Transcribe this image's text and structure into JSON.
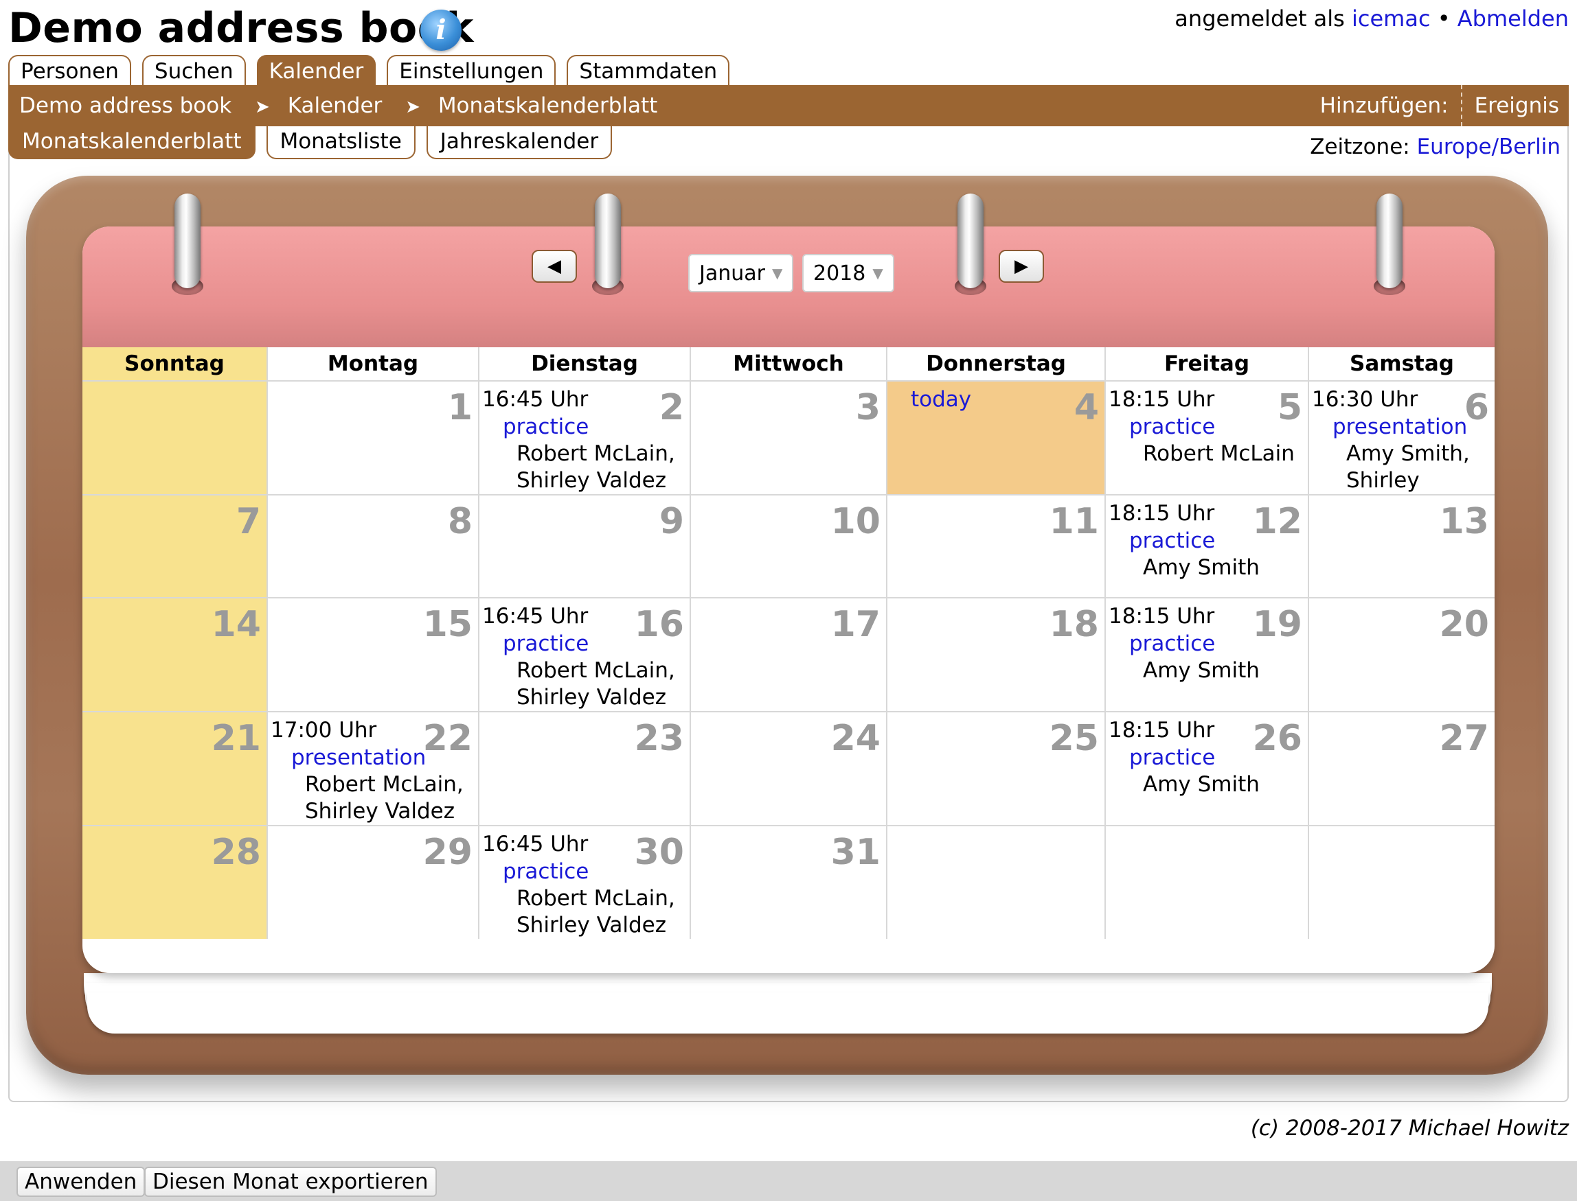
{
  "app": {
    "title": "Demo address book",
    "info_glyph": "i"
  },
  "login": {
    "prefix": "angemeldet als",
    "user": "icemac",
    "bullet": "•",
    "logout": "Abmelden"
  },
  "tabs": [
    {
      "label": "Personen",
      "active": false
    },
    {
      "label": "Suchen",
      "active": false
    },
    {
      "label": "Kalender",
      "active": true
    },
    {
      "label": "Einstellungen",
      "active": false
    },
    {
      "label": "Stammdaten",
      "active": false
    }
  ],
  "breadcrumb": {
    "items": [
      "Demo address book",
      "Kalender",
      "Monatskalenderblatt"
    ],
    "separator": "➤"
  },
  "add": {
    "label": "Hinzufügen:",
    "item": "Ereignis"
  },
  "subtabs": [
    {
      "label": "Monatskalenderblatt",
      "active": true
    },
    {
      "label": "Monatsliste",
      "active": false
    },
    {
      "label": "Jahreskalender",
      "active": false
    }
  ],
  "timezone": {
    "label": "Zeitzone:",
    "value": "Europe/Berlin"
  },
  "calendar": {
    "prev": "◀",
    "next": "▶",
    "month": "Januar",
    "year": "2018",
    "caret": "▼",
    "weekdays": [
      "Sonntag",
      "Montag",
      "Dienstag",
      "Mittwoch",
      "Donnerstag",
      "Freitag",
      "Samstag"
    ],
    "today_label": "today",
    "weeks": [
      [
        {
          "day": ""
        },
        {
          "day": "1"
        },
        {
          "day": "2",
          "event": {
            "time": "16:45 Uhr",
            "title": "practice",
            "people": [
              "Robert McLain,",
              "Shirley Valdez"
            ]
          }
        },
        {
          "day": "3"
        },
        {
          "day": "4",
          "today": true
        },
        {
          "day": "5",
          "event": {
            "time": "18:15 Uhr",
            "title": "practice",
            "people": [
              "Robert McLain"
            ]
          }
        },
        {
          "day": "6",
          "event": {
            "time": "16:30 Uhr",
            "title": "presentation",
            "people": [
              "Amy Smith,",
              "Shirley Valdez"
            ]
          }
        }
      ],
      [
        {
          "day": "7"
        },
        {
          "day": "8"
        },
        {
          "day": "9"
        },
        {
          "day": "10"
        },
        {
          "day": "11"
        },
        {
          "day": "12",
          "event": {
            "time": "18:15 Uhr",
            "title": "practice",
            "people": [
              "Amy Smith"
            ]
          }
        },
        {
          "day": "13"
        }
      ],
      [
        {
          "day": "14"
        },
        {
          "day": "15"
        },
        {
          "day": "16",
          "event": {
            "time": "16:45 Uhr",
            "title": "practice",
            "people": [
              "Robert McLain,",
              "Shirley Valdez"
            ]
          }
        },
        {
          "day": "17"
        },
        {
          "day": "18"
        },
        {
          "day": "19",
          "event": {
            "time": "18:15 Uhr",
            "title": "practice",
            "people": [
              "Amy Smith"
            ]
          }
        },
        {
          "day": "20"
        }
      ],
      [
        {
          "day": "21"
        },
        {
          "day": "22",
          "event": {
            "time": "17:00 Uhr",
            "title": "presentation",
            "people": [
              "Robert McLain,",
              "Shirley Valdez"
            ]
          }
        },
        {
          "day": "23"
        },
        {
          "day": "24"
        },
        {
          "day": "25"
        },
        {
          "day": "26",
          "event": {
            "time": "18:15 Uhr",
            "title": "practice",
            "people": [
              "Amy Smith"
            ]
          }
        },
        {
          "day": "27"
        }
      ],
      [
        {
          "day": "28"
        },
        {
          "day": "29"
        },
        {
          "day": "30",
          "event": {
            "time": "16:45 Uhr",
            "title": "practice",
            "people": [
              "Robert McLain,",
              "Shirley Valdez"
            ]
          }
        },
        {
          "day": "31"
        },
        {
          "day": ""
        },
        {
          "day": ""
        },
        {
          "day": ""
        }
      ]
    ]
  },
  "copyright": "(c) 2008-2017 Michael Howitz",
  "buttons": {
    "apply": "Anwenden",
    "export": "Diesen Monat exportieren"
  },
  "colors": {
    "brand_brown": "#9b6532",
    "link_blue": "#1a1ad6",
    "sunday": "#f8e28e",
    "today": "#f4cb8a",
    "pad_header": "#e88f8f"
  }
}
